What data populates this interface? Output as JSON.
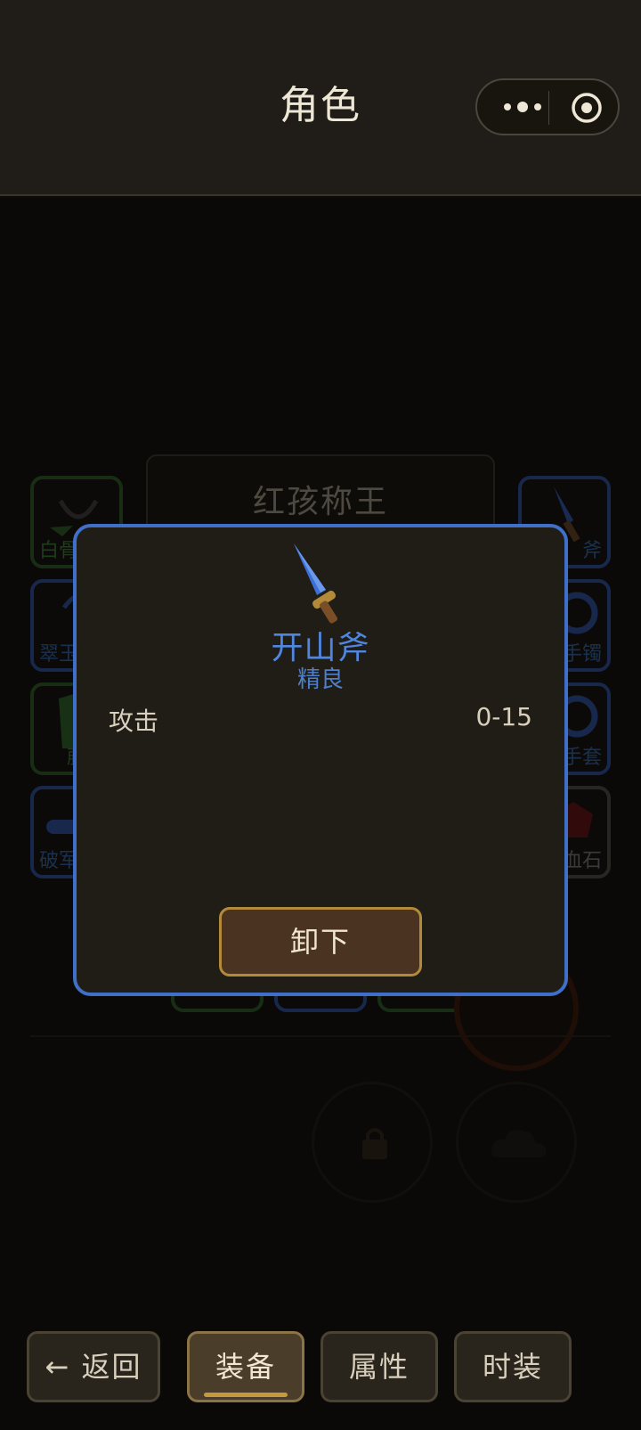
{
  "header": {
    "title": "角色"
  },
  "background": {
    "top_right_text": "",
    "name_card": "红孩称王",
    "left_slots": [
      "白骨",
      "翠玉",
      "藤",
      "破军"
    ],
    "right_slots": [
      "斧",
      "手镯",
      "手套",
      "血石"
    ],
    "bottom_slots": [
      "",
      "",
      ""
    ],
    "circles": [
      "",
      ""
    ]
  },
  "modal": {
    "item_name": "开山斧",
    "item_quality": "精良",
    "stat": {
      "label": "攻击",
      "value": "0-15"
    },
    "unequip_button": "卸下"
  },
  "tabs": [
    {
      "label": "← 返回"
    },
    {
      "label": "装备"
    },
    {
      "label": "属性"
    },
    {
      "label": "时装"
    }
  ],
  "colors": {
    "modal_border": "#3f6fc8",
    "item_name": "#4f86e0",
    "accent_gold": "#c69a3a"
  }
}
